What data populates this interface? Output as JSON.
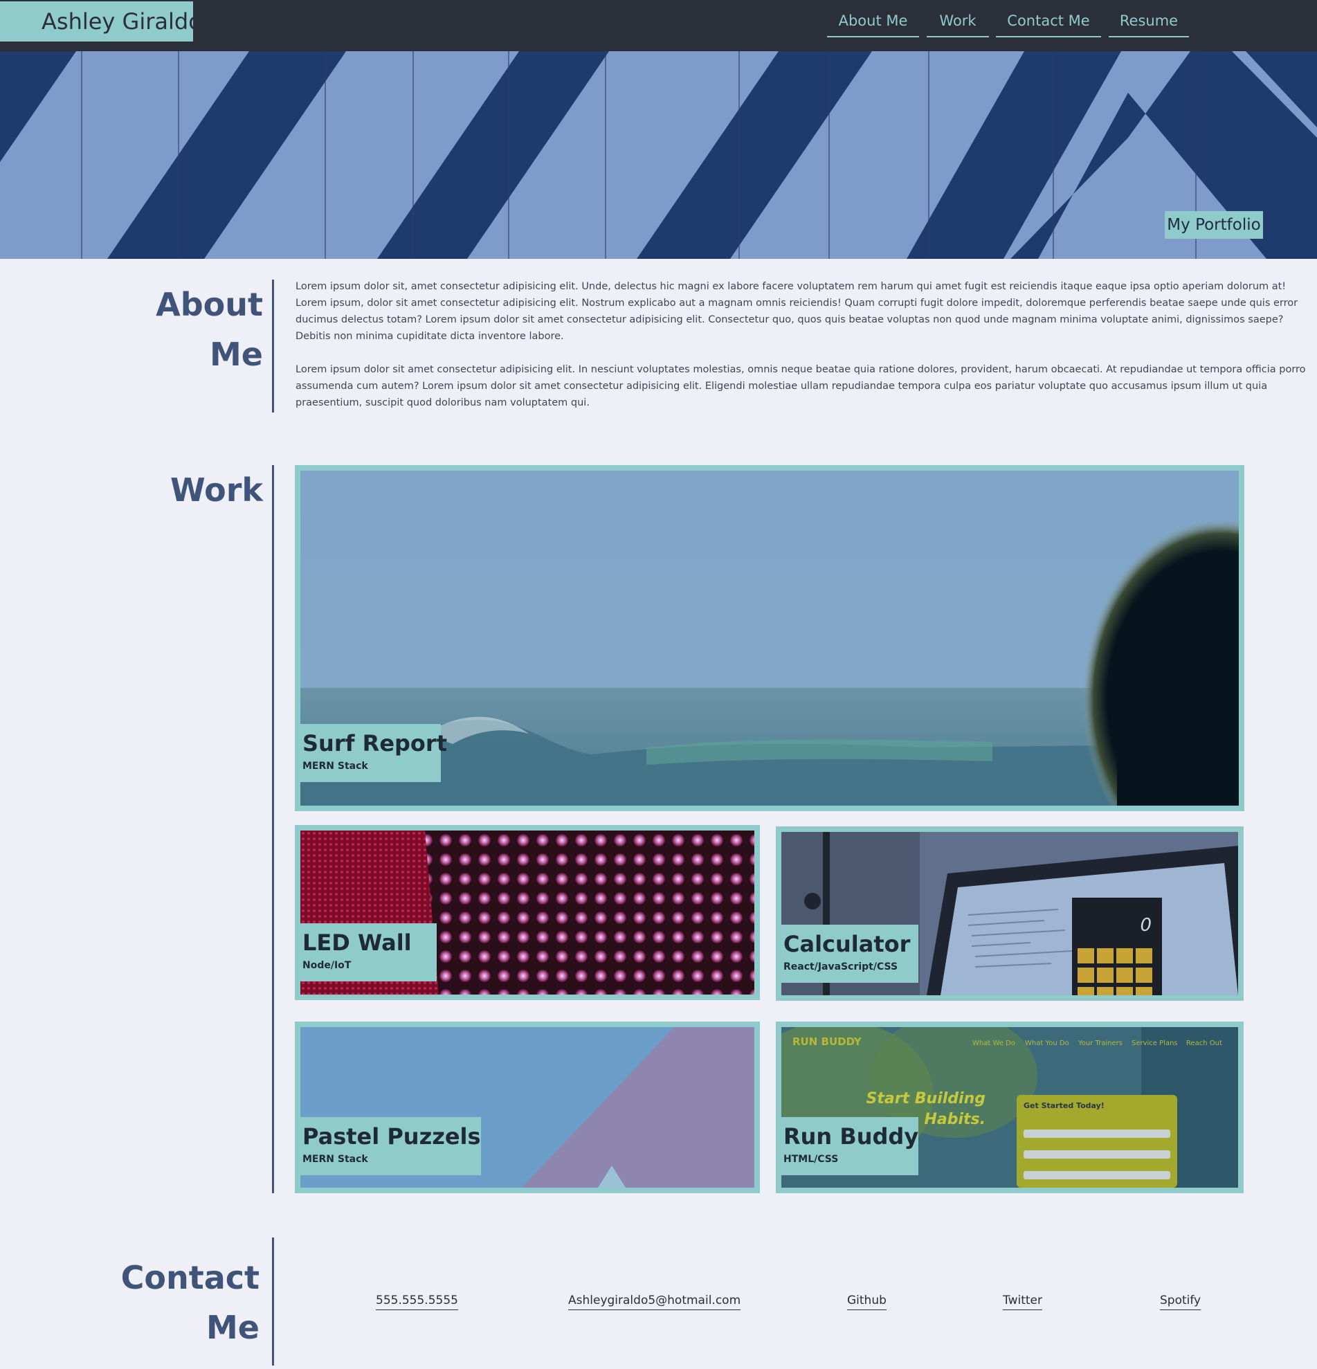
{
  "header": {
    "brand": "Ashley Giraldo",
    "nav": [
      "About Me",
      "Work",
      "Contact Me",
      "Resume"
    ]
  },
  "hero": {
    "tag": "My Portfolio"
  },
  "about": {
    "title_line1": "About",
    "title_line2": "Me",
    "paragraphs": [
      "Lorem ipsum dolor sit, amet consectetur adipisicing elit. Unde, delectus hic magni ex labore facere voluptatem rem harum qui amet fugit est reiciendis itaque eaque ipsa optio aperiam dolorum at! Lorem ipsum, dolor sit amet consectetur adipisicing elit. Nostrum explicabo aut a magnam omnis reiciendis! Quam corrupti fugit dolore impedit, doloremque perferendis beatae saepe unde quis error ducimus delectus totam? Lorem ipsum dolor sit amet consectetur adipisicing elit. Consectetur quo, quos quis beatae voluptas non quod unde magnam minima voluptate animi, dignissimos saepe? Debitis non minima cupiditate dicta inventore labore.",
      "Lorem ipsum dolor sit amet consectetur adipisicing elit. In nesciunt voluptates molestias, omnis neque beatae quia ratione dolores, provident, harum obcaecati. At repudiandae ut tempora officia porro assumenda cum autem? Lorem ipsum dolor sit amet consectetur adipisicing elit. Eligendi molestiae ullam repudiandae tempora culpa eos pariatur voluptate quo accusamus ipsum illum ut quia praesentium, suscipit quod doloribus nam voluptatem qui."
    ]
  },
  "work": {
    "title": "Work",
    "projects": [
      {
        "name": "Surf Report",
        "stack": "MERN Stack"
      },
      {
        "name": "LED Wall",
        "stack": "Node/IoT"
      },
      {
        "name": "Calculator",
        "stack": "React/JavaScript/CSS"
      },
      {
        "name": "Pastel Puzzels",
        "stack": "MERN Stack"
      },
      {
        "name": "Run Buddy",
        "stack": "HTML/CSS"
      }
    ],
    "calculator_display": "0",
    "run_buddy": {
      "logo": "RUN BUDDY",
      "nav": [
        "What We Do",
        "What You Do",
        "Your Trainers",
        "Service Plans",
        "Reach Out"
      ],
      "headline_1": "Start Building",
      "headline_2": "Habits.",
      "form_title": "Get Started Today!"
    }
  },
  "contact": {
    "title_line1": "Contact",
    "title_line2": "Me",
    "links": [
      "555.555.5555",
      "Ashleygiraldo5@hotmail.com",
      "Github",
      "Twitter",
      "Spotify"
    ]
  },
  "colors": {
    "header_bg": "#2b2f3a",
    "accent": "#90cbcb",
    "page_bg": "#eff0f7",
    "heading": "#3f5478",
    "hero_light": "#7f9bcc",
    "hero_dark": "#1f3b6e"
  }
}
